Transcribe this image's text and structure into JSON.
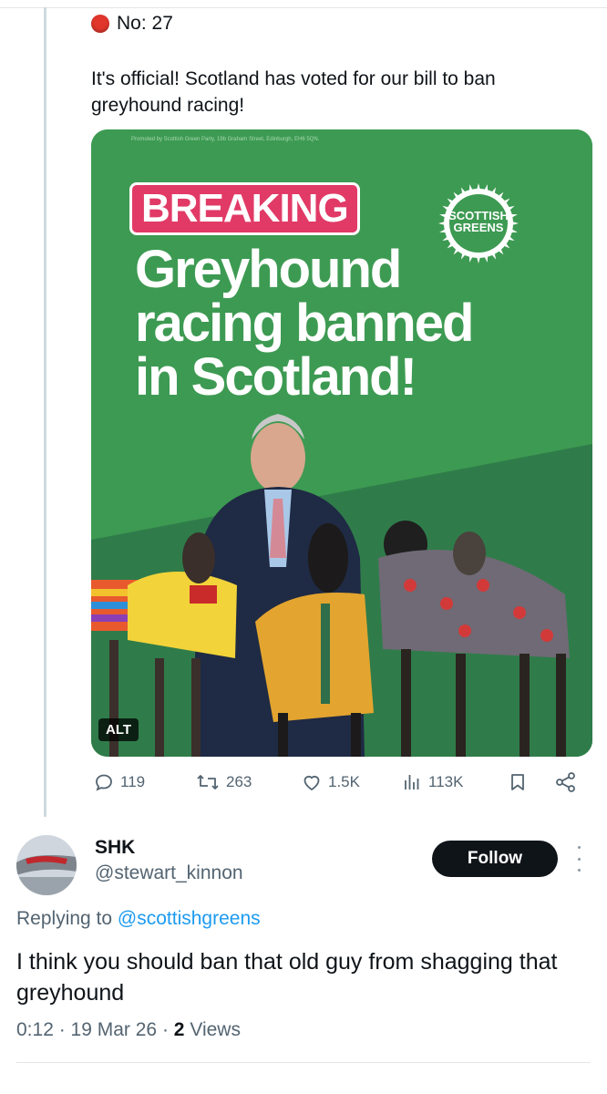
{
  "status": {
    "label": "No: 27"
  },
  "tweet": {
    "text": "It's official! Scotland has voted for our bill to ban greyhound racing!",
    "media": {
      "promoted_line": "Promoted by Scottish Green Party, 19b Graham Street, Edinburgh, EH6 5QN.",
      "badge": "BREAKING",
      "headline_line1": "Greyhound",
      "headline_line2": "racing banned",
      "headline_line3": "in Scotland!",
      "logo_line1": "SCOTTISH",
      "logo_line2": "GREENS",
      "alt_label": "ALT"
    },
    "actions": {
      "replies": "119",
      "reposts": "263",
      "likes": "1.5K",
      "views": "113K"
    }
  },
  "reply": {
    "name": "SHK",
    "handle": "@stewart_kinnon",
    "follow_label": "Follow",
    "replying_prefix": "Replying to ",
    "replying_to": "@scottishgreens",
    "text": "I think you should ban that old guy from shagging that greyhound",
    "time": "0:12",
    "date": "19 Mar 26",
    "views_count": "2",
    "views_label": "Views"
  },
  "colors": {
    "poster_green": "#3d9a52",
    "poster_dark_green": "#2f7c4a",
    "breaking_pink": "#e13a66",
    "link_blue": "#1d9bf0"
  }
}
